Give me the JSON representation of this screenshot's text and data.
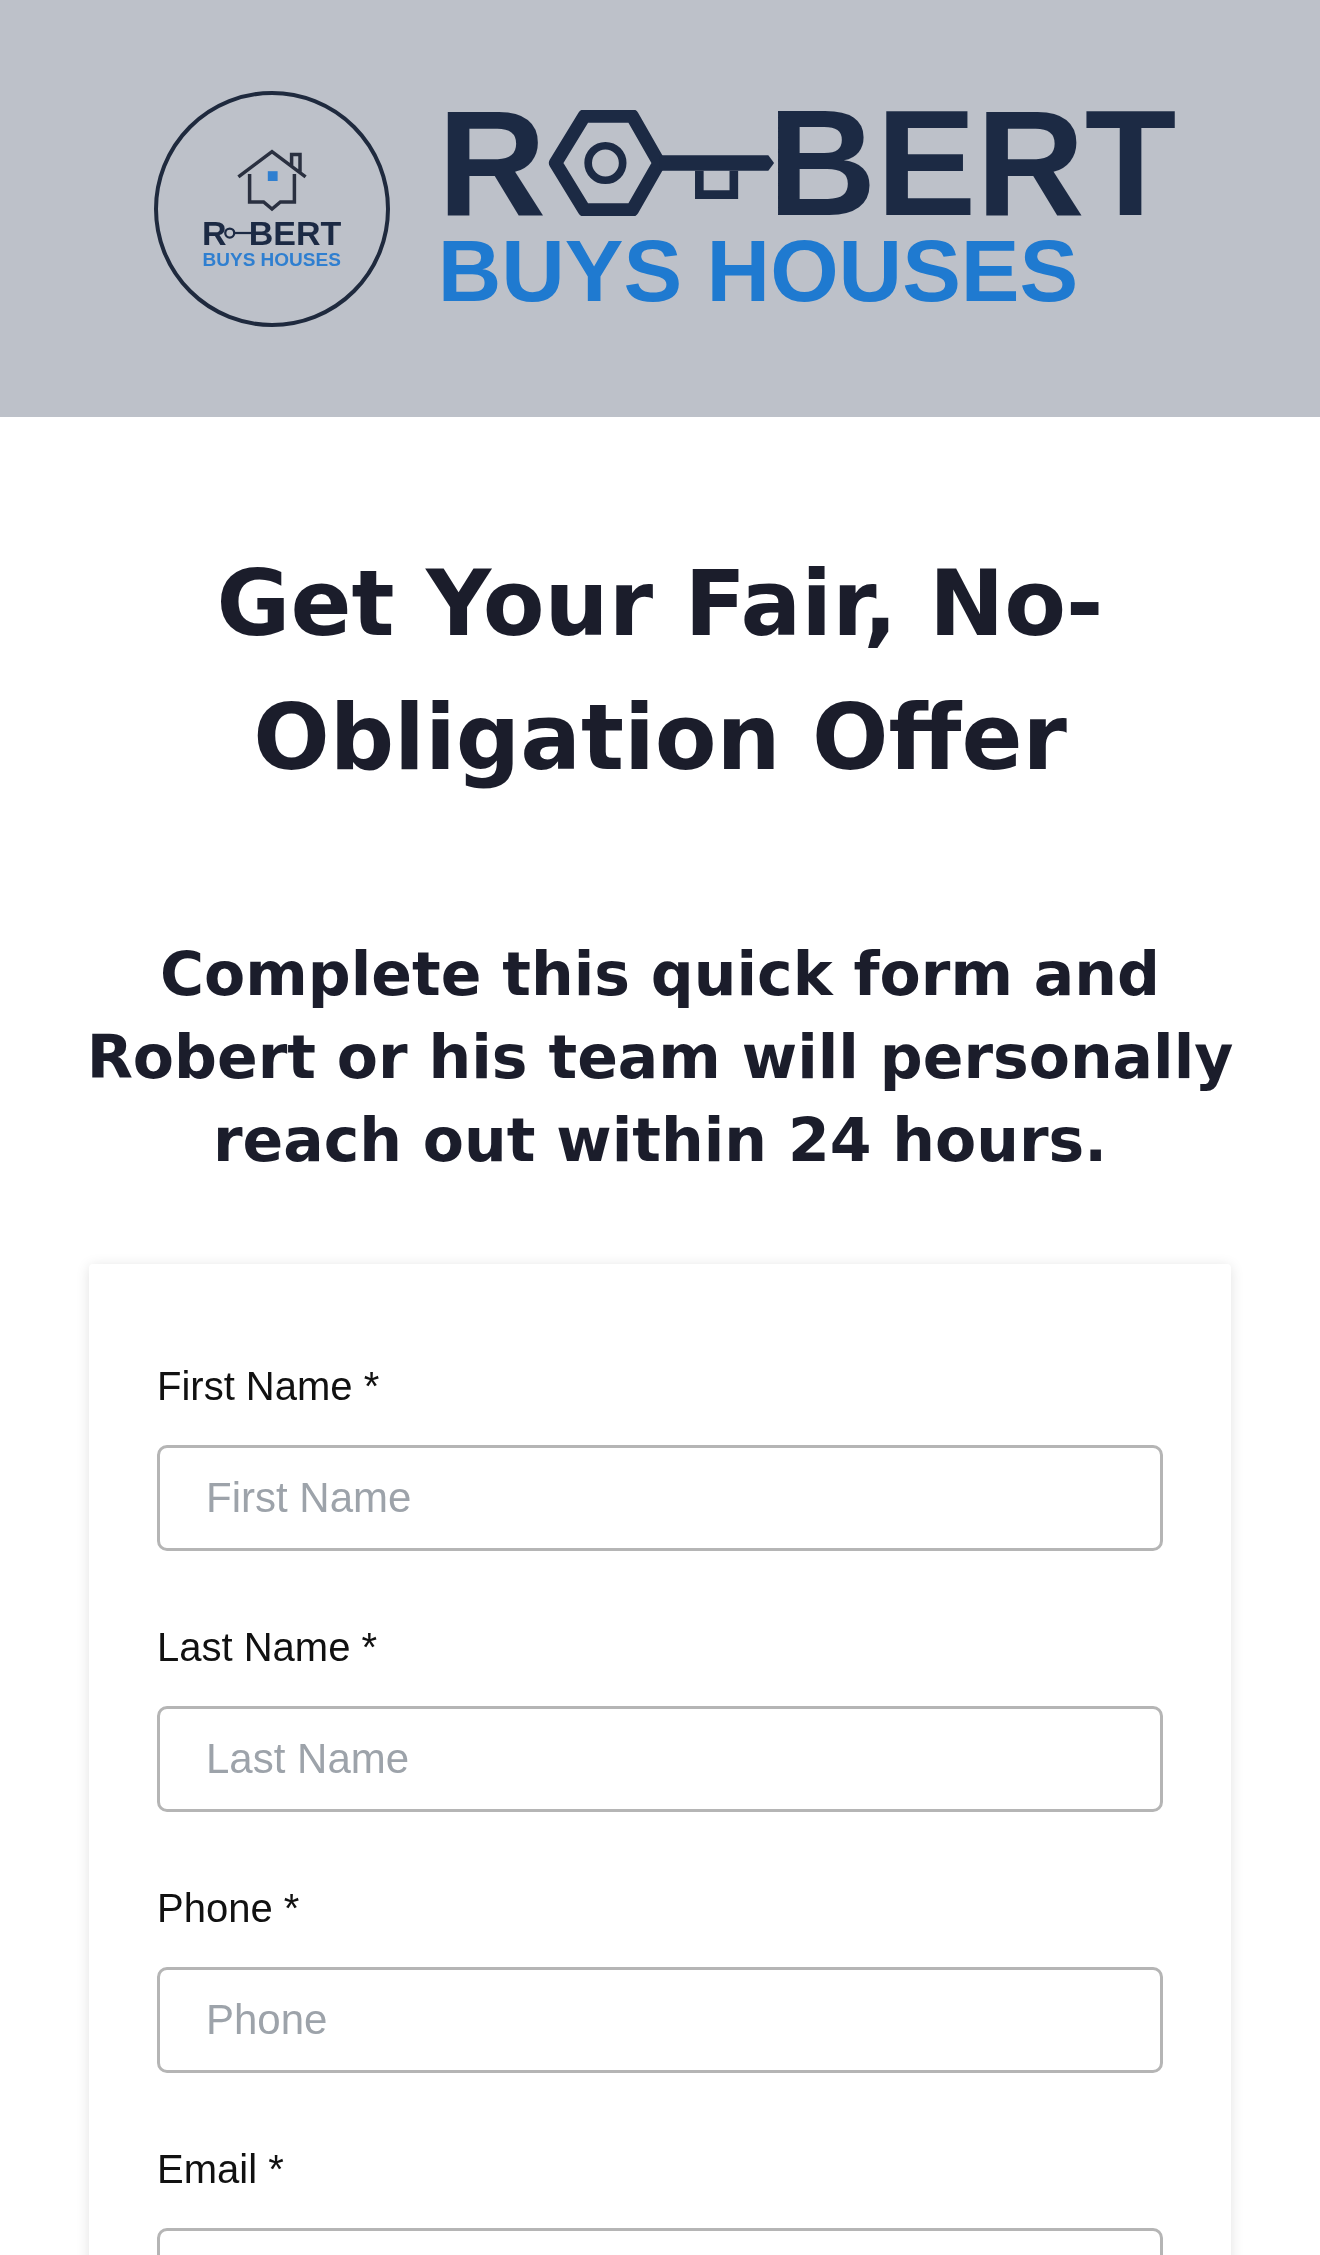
{
  "header": {
    "badge": {
      "name_start": "R",
      "name_end": "BERT",
      "tagline": "BUYS HOUSES"
    },
    "logo": {
      "name_start": "R",
      "name_end": "BERT",
      "tagline": "BUYS HOUSES"
    }
  },
  "heading": "Get Your Fair, No-Obligation Offer",
  "subheading": "Complete this quick form and Robert or his team will personally reach out within 24 hours.",
  "form": {
    "fields": [
      {
        "label": "First Name *",
        "placeholder": "First Name"
      },
      {
        "label": "Last Name *",
        "placeholder": "Last Name"
      },
      {
        "label": "Phone *",
        "placeholder": "Phone"
      },
      {
        "label": "Email *"
      }
    ]
  }
}
